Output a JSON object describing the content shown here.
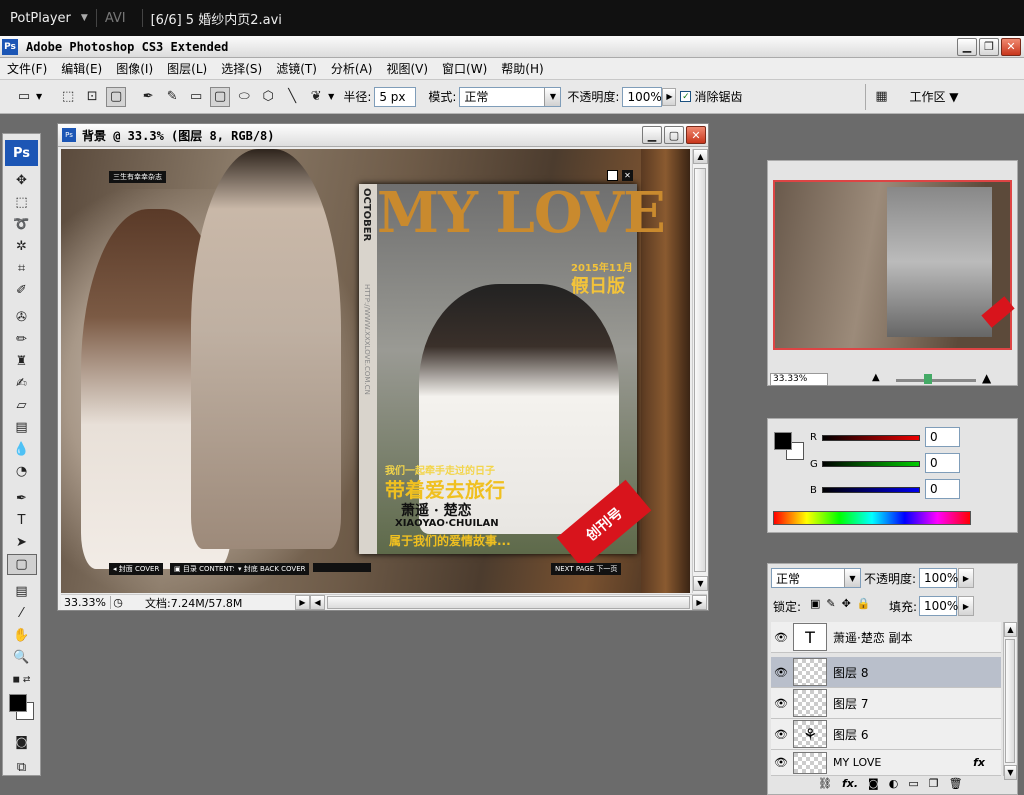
{
  "potplayer": {
    "brand": "PotPlayer",
    "format": "AVI",
    "title": "[6/6] 5 婚纱内页2.avi"
  },
  "app": {
    "title": "Adobe Photoshop CS3 Extended",
    "icon": "Ps"
  },
  "menu": [
    "文件(F)",
    "编辑(E)",
    "图像(I)",
    "图层(L)",
    "选择(S)",
    "滤镜(T)",
    "分析(A)",
    "视图(V)",
    "窗口(W)",
    "帮助(H)"
  ],
  "options": {
    "radius_label": "半径:",
    "radius_value": "5 px",
    "mode_label": "模式:",
    "mode_value": "正常",
    "opacity_label": "不透明度:",
    "opacity_value": "100%",
    "antialias_label": "消除锯齿",
    "workspace_label": "工作区 ▼"
  },
  "document": {
    "title": "背景 @ 33.3% (图层 8, RGB/8)",
    "zoom": "33.33%",
    "docinfo": "文档:7.24M/57.8M",
    "canvas": {
      "tag_top": "三生有幸幸杂志",
      "magazine_title": "MY LOVE",
      "october": "OCTOBER",
      "spine_url": "HTTP://WWW.XXXLOVE.COM.CN",
      "date": "2015年11月1日",
      "issue": "假日版",
      "subtitle": "我们一起牵手走过的日子",
      "headline": "带着爱去旅行",
      "names_cn": "萧遥 · 楚恋",
      "names_en": "XIAOYAO·CHUILAN",
      "story": "属于我们的爱情故事...",
      "badge": "创刊号",
      "nav_cover": "◂ 封面 COVER",
      "nav_contents": "▣ 目录 CONTENTS",
      "nav_back": "▾ 封底 BACK COVER",
      "nav_next": "NEXT PAGE 下一页"
    }
  },
  "navigator": {
    "zoom": "33.33%"
  },
  "color": {
    "r_label": "R",
    "g_label": "G",
    "b_label": "B",
    "r": "0",
    "g": "0",
    "b": "0"
  },
  "layers": {
    "mode": "正常",
    "opacity_label": "不透明度:",
    "opacity": "100%",
    "lock_label": "锁定:",
    "fill_label": "填充:",
    "fill": "100%",
    "items": [
      {
        "name": "萧遥·楚恋 副本",
        "type": "text",
        "thumb": "T"
      },
      {
        "name": "图层 8",
        "type": "pixel",
        "thumb": ""
      },
      {
        "name": "图层 7",
        "type": "pixel",
        "thumb": ""
      },
      {
        "name": "图层 6",
        "type": "pixel",
        "thumb": "⚘"
      },
      {
        "name": "MY LOVE",
        "type": "pixel",
        "thumb": "",
        "fx": "fx"
      }
    ]
  }
}
